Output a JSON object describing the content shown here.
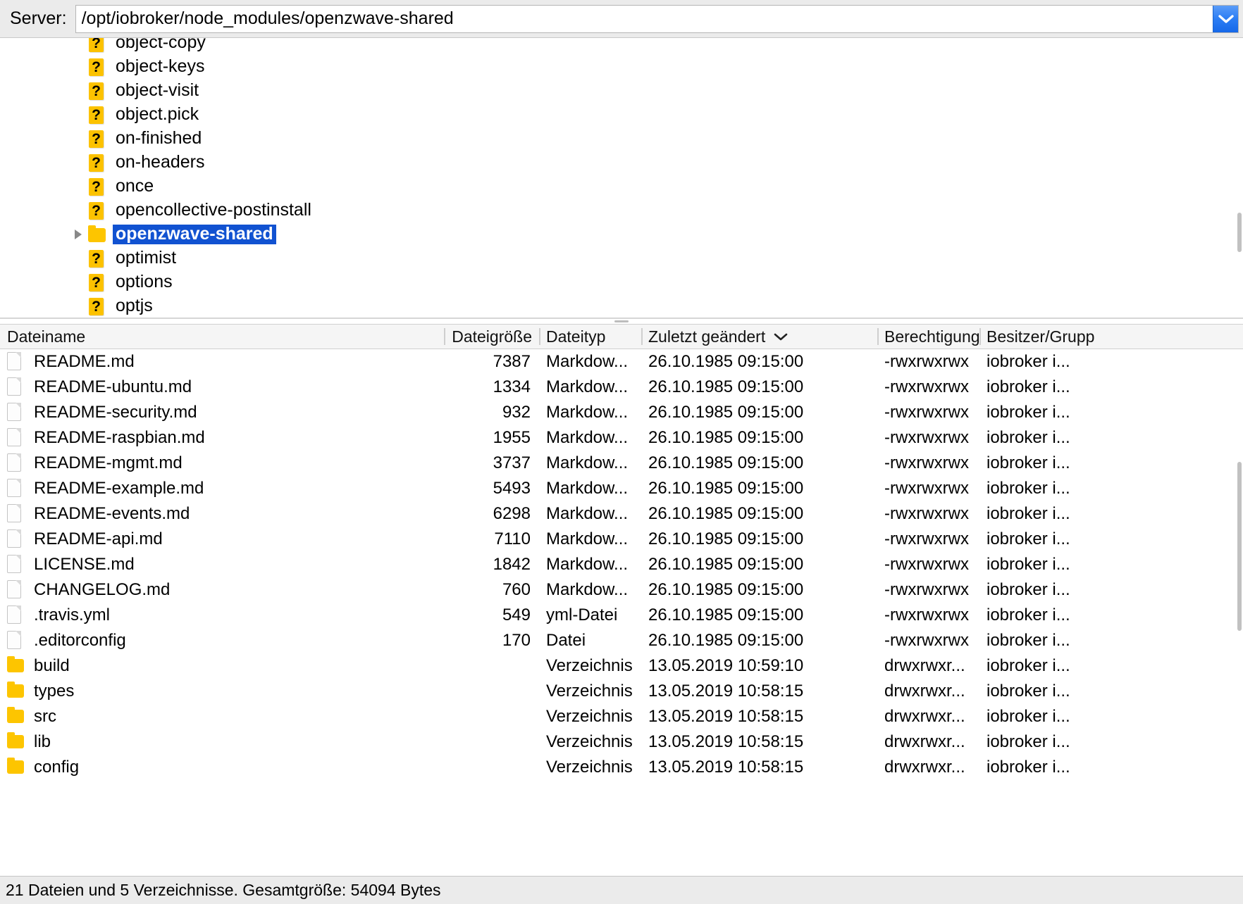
{
  "server_bar": {
    "label": "Server:",
    "path_value": "/opt/iobroker/node_modules/openzwave-shared",
    "path_placeholder": "",
    "dropdown_icon": "chevron-down-icon",
    "dropdown_color": "#2b7df4"
  },
  "tree": {
    "items": [
      {
        "label": "object-copy",
        "icon": "unknown-file-icon",
        "expandable": false,
        "selected": false
      },
      {
        "label": "object-keys",
        "icon": "unknown-file-icon",
        "expandable": false,
        "selected": false
      },
      {
        "label": "object-visit",
        "icon": "unknown-file-icon",
        "expandable": false,
        "selected": false
      },
      {
        "label": "object.pick",
        "icon": "unknown-file-icon",
        "expandable": false,
        "selected": false
      },
      {
        "label": "on-finished",
        "icon": "unknown-file-icon",
        "expandable": false,
        "selected": false
      },
      {
        "label": "on-headers",
        "icon": "unknown-file-icon",
        "expandable": false,
        "selected": false
      },
      {
        "label": "once",
        "icon": "unknown-file-icon",
        "expandable": false,
        "selected": false
      },
      {
        "label": "opencollective-postinstall",
        "icon": "unknown-file-icon",
        "expandable": false,
        "selected": false
      },
      {
        "label": "openzwave-shared",
        "icon": "folder-icon",
        "expandable": true,
        "selected": true
      },
      {
        "label": "optimist",
        "icon": "unknown-file-icon",
        "expandable": false,
        "selected": false
      },
      {
        "label": "options",
        "icon": "unknown-file-icon",
        "expandable": false,
        "selected": false
      },
      {
        "label": "optjs",
        "icon": "unknown-file-icon",
        "expandable": false,
        "selected": false
      }
    ],
    "selection_color": "#1152d1"
  },
  "filelist": {
    "columns": [
      {
        "key": "name",
        "label": "Dateiname",
        "align": "left",
        "sorted": false
      },
      {
        "key": "size",
        "label": "Dateigröße",
        "align": "right",
        "sorted": false
      },
      {
        "key": "type",
        "label": "Dateityp",
        "align": "left",
        "sorted": false
      },
      {
        "key": "mod",
        "label": "Zuletzt geändert",
        "align": "left",
        "sorted": true,
        "sort_direction": "desc"
      },
      {
        "key": "perm",
        "label": "Berechtigunge",
        "align": "left",
        "sorted": false
      },
      {
        "key": "own",
        "label": "Besitzer/Grupp",
        "align": "left",
        "sorted": false
      }
    ],
    "rows": [
      {
        "icon": "document-icon",
        "name": "README.md",
        "size": "7387",
        "type": "Markdow...",
        "mod": "26.10.1985 09:15:00",
        "perm": "-rwxrwxrwx",
        "own": "iobroker i..."
      },
      {
        "icon": "document-icon",
        "name": "README-ubuntu.md",
        "size": "1334",
        "type": "Markdow...",
        "mod": "26.10.1985 09:15:00",
        "perm": "-rwxrwxrwx",
        "own": "iobroker i..."
      },
      {
        "icon": "document-icon",
        "name": "README-security.md",
        "size": "932",
        "type": "Markdow...",
        "mod": "26.10.1985 09:15:00",
        "perm": "-rwxrwxrwx",
        "own": "iobroker i..."
      },
      {
        "icon": "document-icon",
        "name": "README-raspbian.md",
        "size": "1955",
        "type": "Markdow...",
        "mod": "26.10.1985 09:15:00",
        "perm": "-rwxrwxrwx",
        "own": "iobroker i..."
      },
      {
        "icon": "document-icon",
        "name": "README-mgmt.md",
        "size": "3737",
        "type": "Markdow...",
        "mod": "26.10.1985 09:15:00",
        "perm": "-rwxrwxrwx",
        "own": "iobroker i..."
      },
      {
        "icon": "document-icon",
        "name": "README-example.md",
        "size": "5493",
        "type": "Markdow...",
        "mod": "26.10.1985 09:15:00",
        "perm": "-rwxrwxrwx",
        "own": "iobroker i..."
      },
      {
        "icon": "document-icon",
        "name": "README-events.md",
        "size": "6298",
        "type": "Markdow...",
        "mod": "26.10.1985 09:15:00",
        "perm": "-rwxrwxrwx",
        "own": "iobroker i..."
      },
      {
        "icon": "document-icon",
        "name": "README-api.md",
        "size": "7110",
        "type": "Markdow...",
        "mod": "26.10.1985 09:15:00",
        "perm": "-rwxrwxrwx",
        "own": "iobroker i..."
      },
      {
        "icon": "document-icon",
        "name": "LICENSE.md",
        "size": "1842",
        "type": "Markdow...",
        "mod": "26.10.1985 09:15:00",
        "perm": "-rwxrwxrwx",
        "own": "iobroker i..."
      },
      {
        "icon": "document-icon",
        "name": "CHANGELOG.md",
        "size": "760",
        "type": "Markdow...",
        "mod": "26.10.1985 09:15:00",
        "perm": "-rwxrwxrwx",
        "own": "iobroker i..."
      },
      {
        "icon": "document-icon",
        "name": ".travis.yml",
        "size": "549",
        "type": "yml-Datei",
        "mod": "26.10.1985 09:15:00",
        "perm": "-rwxrwxrwx",
        "own": "iobroker i..."
      },
      {
        "icon": "document-icon",
        "name": ".editorconfig",
        "size": "170",
        "type": "Datei",
        "mod": "26.10.1985 09:15:00",
        "perm": "-rwxrwxrwx",
        "own": "iobroker i..."
      },
      {
        "icon": "folder-icon",
        "name": "build",
        "size": "",
        "type": "Verzeichnis",
        "mod": "13.05.2019 10:59:10",
        "perm": "drwxrwxr...",
        "own": "iobroker i..."
      },
      {
        "icon": "folder-icon",
        "name": "types",
        "size": "",
        "type": "Verzeichnis",
        "mod": "13.05.2019 10:58:15",
        "perm": "drwxrwxr...",
        "own": "iobroker i..."
      },
      {
        "icon": "folder-icon",
        "name": "src",
        "size": "",
        "type": "Verzeichnis",
        "mod": "13.05.2019 10:58:15",
        "perm": "drwxrwxr...",
        "own": "iobroker i..."
      },
      {
        "icon": "folder-icon",
        "name": "lib",
        "size": "",
        "type": "Verzeichnis",
        "mod": "13.05.2019 10:58:15",
        "perm": "drwxrwxr...",
        "own": "iobroker i..."
      },
      {
        "icon": "folder-icon",
        "name": "config",
        "size": "",
        "type": "Verzeichnis",
        "mod": "13.05.2019 10:58:15",
        "perm": "drwxrwxr...",
        "own": "iobroker i..."
      }
    ]
  },
  "status_bar": {
    "text": "21 Dateien und 5 Verzeichnisse. Gesamtgröße: 54094 Bytes"
  }
}
